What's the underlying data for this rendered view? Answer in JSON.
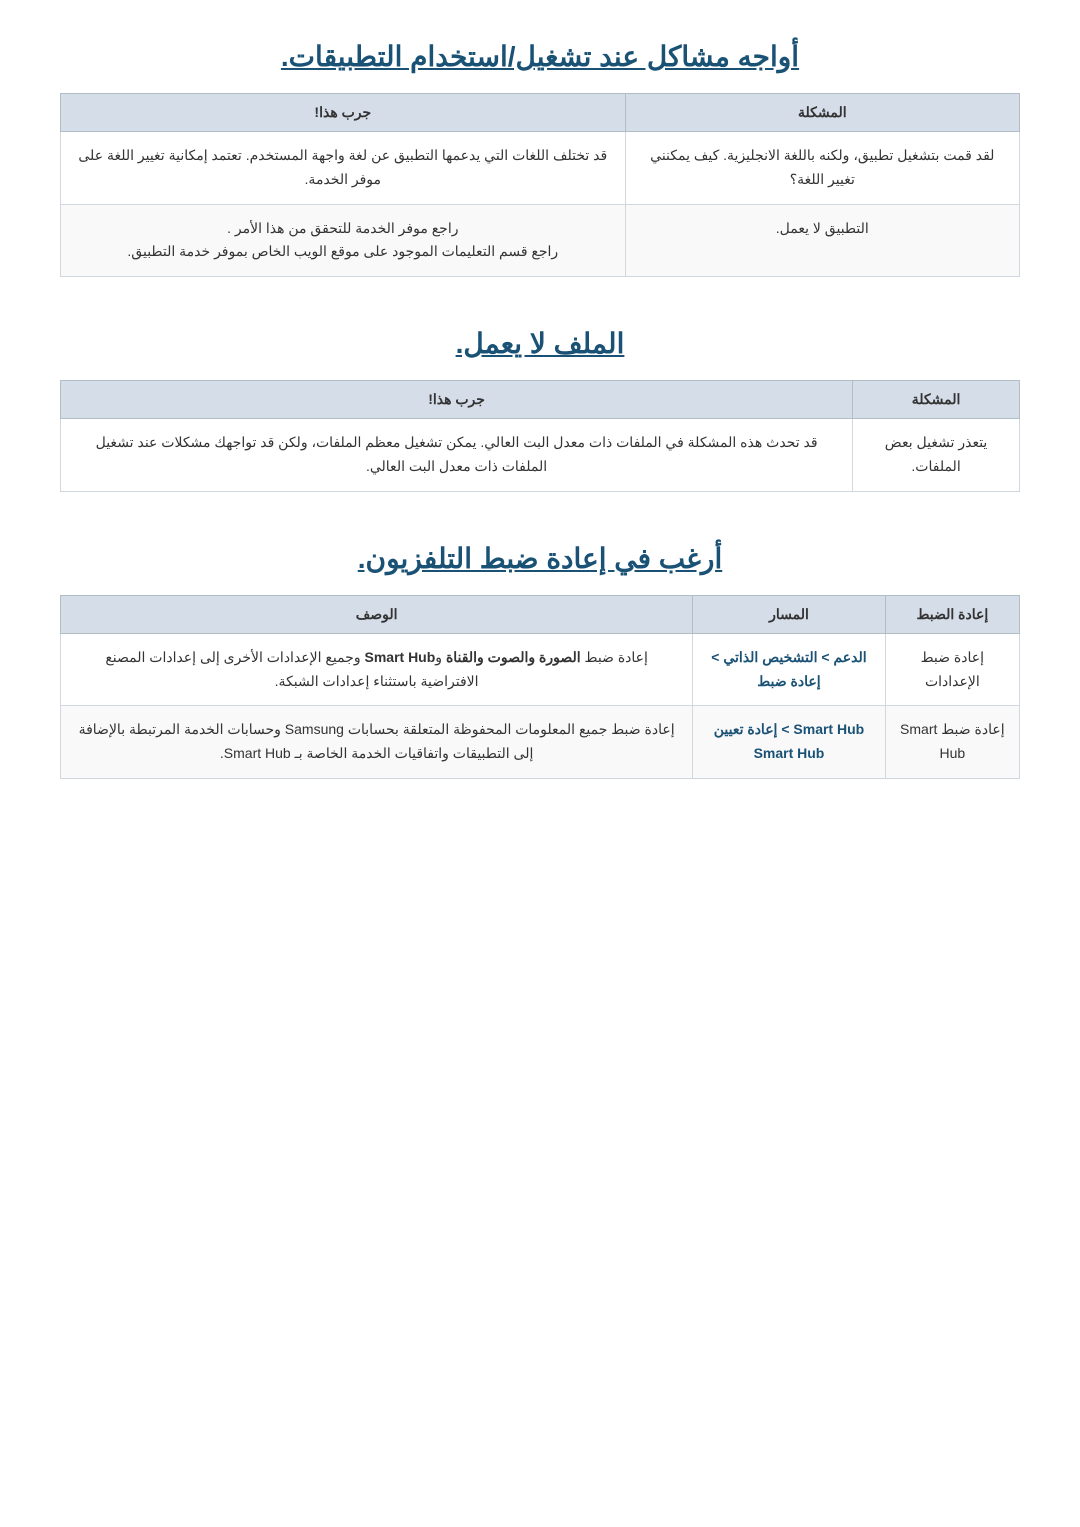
{
  "section1": {
    "title": "أواجه مشاكل عند تشغيل/استخدام التطبيقات.",
    "table": {
      "headers": [
        "المشكلة",
        "جرب هذا!"
      ],
      "rows": [
        {
          "problem": "لقد قمت بتشغيل تطبيق، ولكنه باللغة الانجليزية. كيف يمكنني تغيير اللغة؟",
          "solution": "قد تختلف اللغات التي يدعمها التطبيق عن لغة واجهة المستخدم. تعتمد إمكانية تغيير اللغة على موفر الخدمة."
        },
        {
          "problem": "التطبيق لا يعمل.",
          "solution": "راجع موفر الخدمة للتحقق من هذا الأمر .\nراجع قسم التعليمات الموجود على موقع الويب الخاص بموفر خدمة التطبيق."
        }
      ]
    }
  },
  "section2": {
    "title": "الملف لا يعمل.",
    "table": {
      "headers": [
        "المشكلة",
        "جرب هذا!"
      ],
      "rows": [
        {
          "problem": "يتعذر تشغيل بعض الملفات.",
          "solution": "قد تحدث هذه المشكلة في الملفات ذات معدل البت العالي. يمكن تشغيل معظم الملفات، ولكن قد تواجهك مشكلات عند تشغيل الملفات ذات معدل البت العالي."
        }
      ]
    }
  },
  "section3": {
    "title": "أرغب في إعادة ضبط التلفزيون.",
    "table": {
      "headers": [
        "إعادة الضبط",
        "المسار",
        "الوصف"
      ],
      "rows": [
        {
          "reset": "إعادة ضبط الإعدادات",
          "path_bold": "الدعم > التشخيص الذاتي > إعادة ضبط",
          "path_normal": "",
          "description": "إعادة ضبط الصورة والصوت والقناة وSmart Hub وجميع الإعدادات الأخرى إلى إعدادات المصنع الافتراضية باستثناء إعدادات الشبكة."
        },
        {
          "reset": "إعادة ضبط Smart Hub",
          "path_bold": "Smart Hub > إعادة تعيين Smart Hub",
          "path_normal": "",
          "description": "إعادة ضبط جميع المعلومات المحفوظة المتعلقة بحسابات Samsung وحسابات الخدمة المرتبطة بالإضافة إلى التطبيقات واتفاقيات الخدمة الخاصة بـ Smart Hub."
        }
      ]
    }
  }
}
